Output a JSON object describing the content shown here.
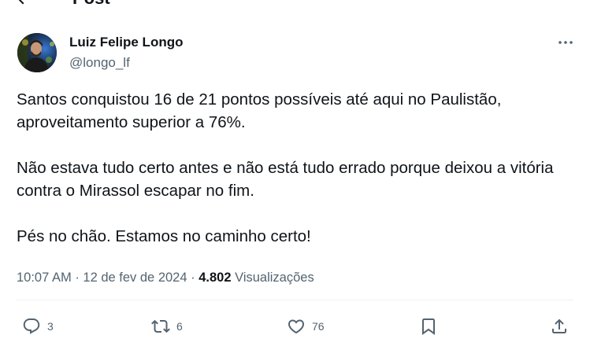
{
  "header": {
    "title": "Post"
  },
  "author": {
    "name": "Luiz Felipe Longo",
    "handle": "@longo_lf"
  },
  "tweet": {
    "paragraphs": [
      "Santos conquistou 16 de 21 pontos possíveis até aqui no Paulistão, aproveitamento superior a 76%.",
      "Não estava tudo certo antes e não está tudo errado porque deixou a vitória contra o Mirassol escapar no fim.",
      "Pés no chão. Estamos no caminho certo!"
    ]
  },
  "meta": {
    "time": "10:07 AM",
    "separator": "·",
    "date": "12 de fev de 2024",
    "views_count": "4.802",
    "views_label": "Visualizações"
  },
  "actions": {
    "reply_count": "3",
    "repost_count": "6",
    "like_count": "76"
  },
  "icons": {
    "back": "arrow-left-icon",
    "more": "more-horizontal-icon",
    "reply": "reply-icon",
    "repost": "repost-icon",
    "like": "heart-icon",
    "bookmark": "bookmark-icon",
    "share": "share-icon"
  },
  "colors": {
    "text_primary": "#0f1419",
    "text_secondary": "#536471",
    "divider": "#eff3f4"
  }
}
